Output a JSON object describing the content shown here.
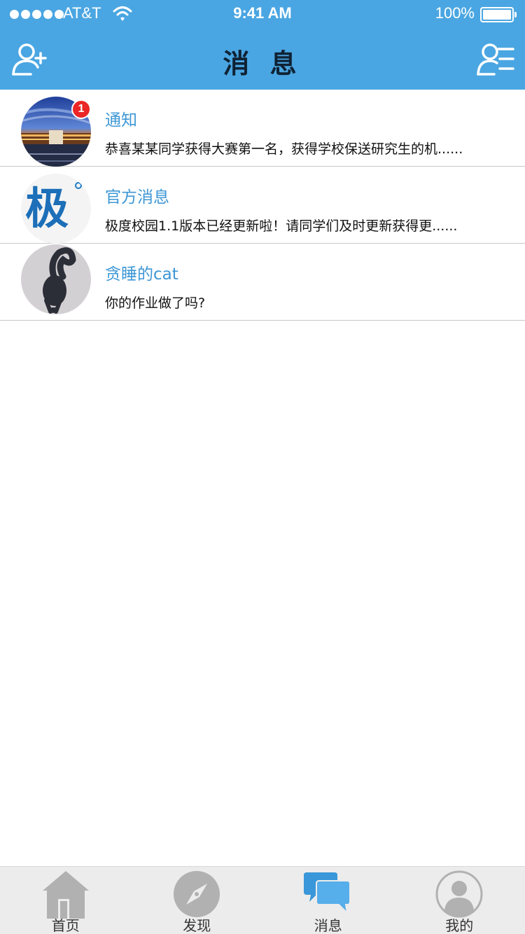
{
  "status_bar": {
    "carrier": "AT&T",
    "time": "9:41 AM",
    "battery": "100%"
  },
  "header": {
    "title": "消 息",
    "left_icon": "add-friend-icon",
    "right_icon": "contacts-list-icon",
    "bg_color": "#4aa6e2"
  },
  "messages": [
    {
      "title": "通知",
      "preview": "恭喜某某同学获得大赛第一名，获得学校保送研究生的机......",
      "badge": "1",
      "avatar": "campus-night-photo"
    },
    {
      "title": "官方消息",
      "preview": "极度校园1.1版本已经更新啦！请同学们及时更新获得更......",
      "avatar": "logo-ji",
      "logo_text": "极"
    },
    {
      "title": "贪睡的cat",
      "preview": "你的作业做了吗?",
      "avatar": "cat-photo"
    }
  ],
  "tabbar": {
    "tabs": [
      {
        "label": "首页",
        "icon": "home-icon"
      },
      {
        "label": "发现",
        "icon": "compass-icon"
      },
      {
        "label": "消息",
        "icon": "chat-bubbles-icon",
        "active": true
      },
      {
        "label": "我的",
        "icon": "profile-icon"
      }
    ]
  }
}
